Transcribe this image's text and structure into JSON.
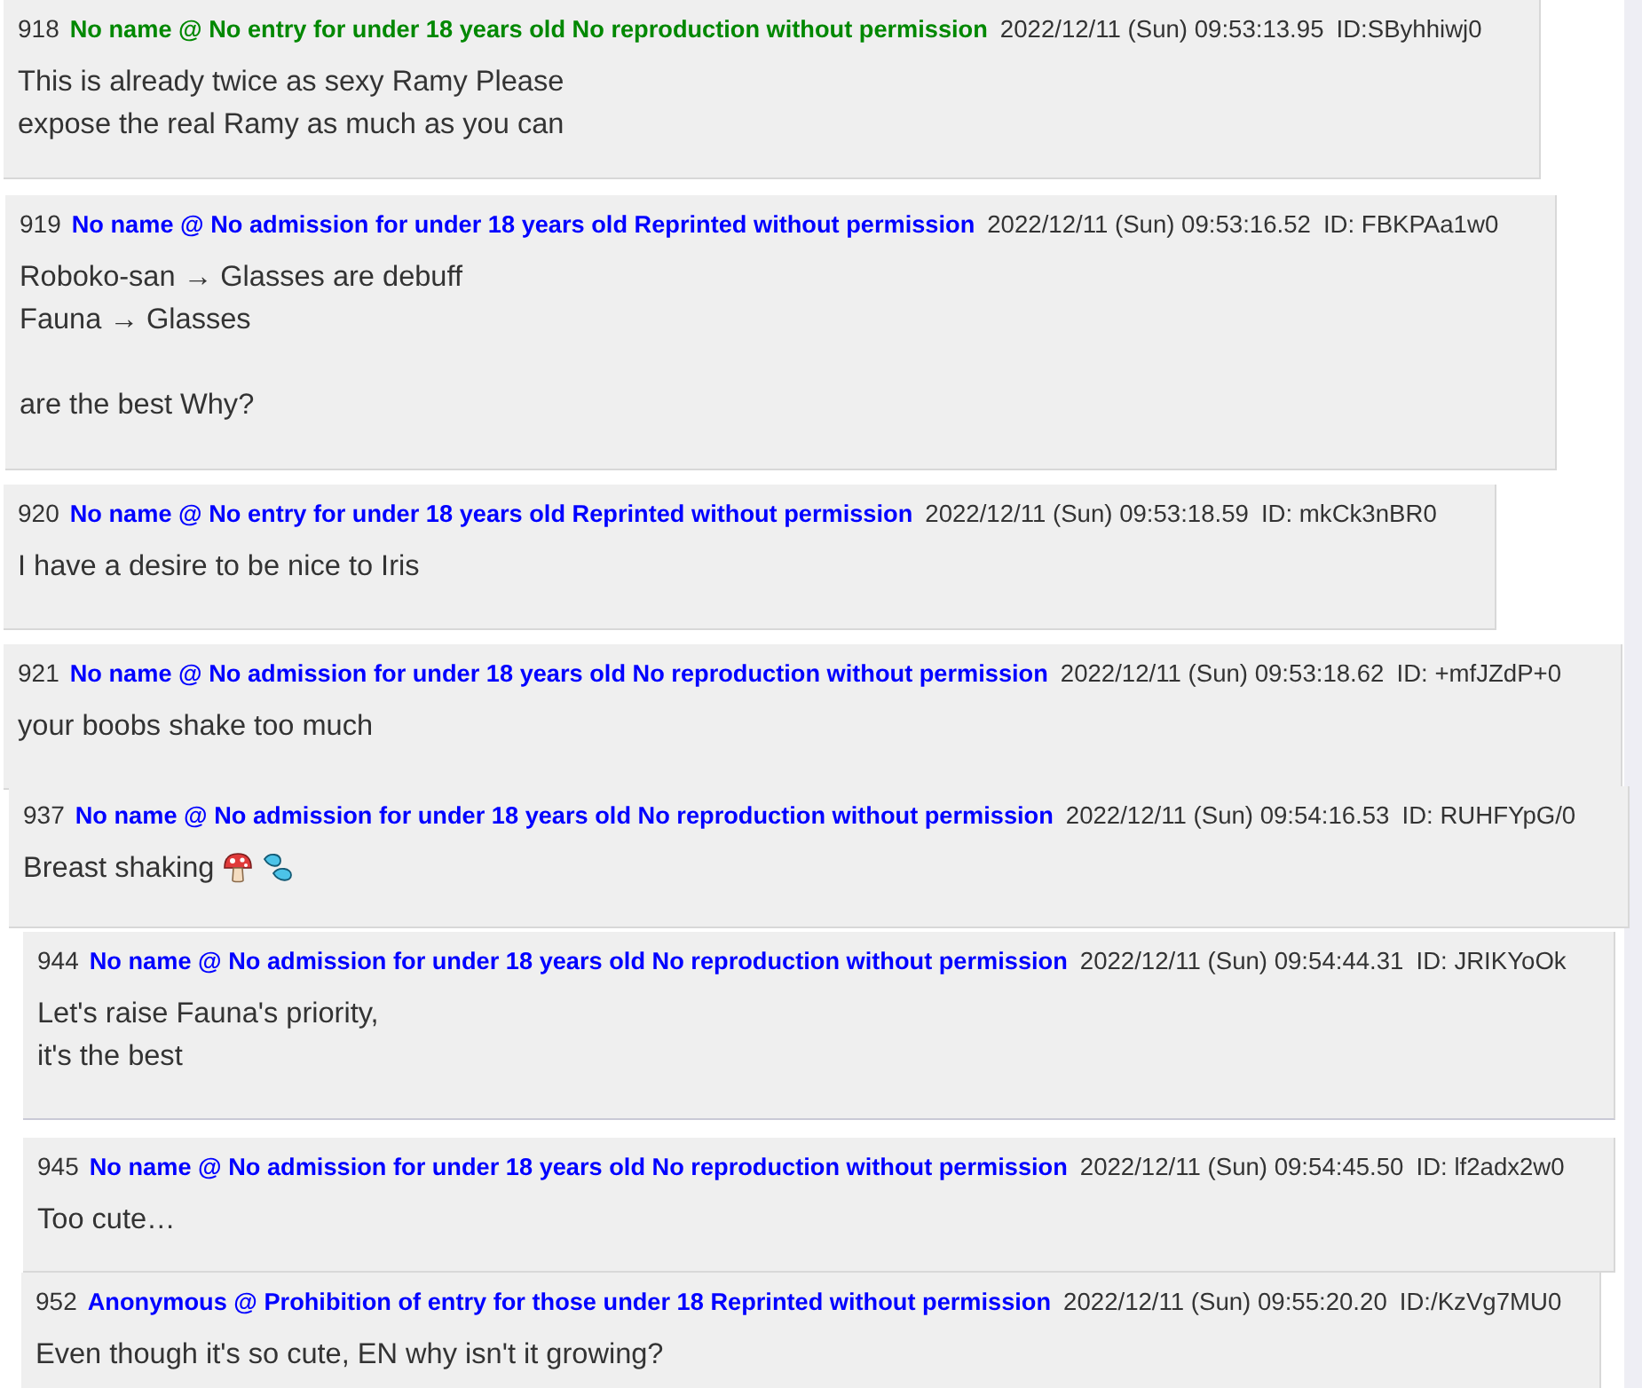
{
  "posts": [
    {
      "number": "918",
      "name": "No name @ No entry for under 18 years old No reproduction without permission",
      "color": "#008800",
      "date": "2022/12/11 (Sun) 09:53:13.95",
      "id": "ID:SByhhiwj0",
      "paragraphs": [
        [
          "This is already twice as sexy Ramy Please",
          "expose the real Ramy as much as you can"
        ]
      ]
    },
    {
      "number": "919",
      "name": "No name @ No admission for under 18 years old Reprinted without permission",
      "color": "#0000ff",
      "date": "2022/12/11 (Sun) 09:53:16.52",
      "id": "ID: FBKPAa1w0",
      "paragraphs": [
        [
          "Roboko-san → Glasses are debuff",
          "Fauna → Glasses"
        ],
        [
          "are the best Why?"
        ]
      ]
    },
    {
      "number": "920",
      "name": "No name @ No entry for under 18 years old Reprinted without permission",
      "color": "#0000ff",
      "date": "2022/12/11 (Sun) 09:53:18.59",
      "id": "ID: mkCk3nBR0",
      "paragraphs": [
        [
          "I have a desire to be nice to Iris"
        ]
      ]
    },
    {
      "number": "921",
      "name": "No name @ No admission for under 18 years old No reproduction without permission",
      "color": "#0000ff",
      "date": "2022/12/11 (Sun) 09:53:18.62",
      "id": "ID: +mfJZdP+0",
      "paragraphs": [
        [
          "your boobs shake too much"
        ]
      ]
    },
    {
      "number": "937",
      "name": "No name @ No admission for under 18 years old No reproduction without permission",
      "color": "#0000ff",
      "date": "2022/12/11 (Sun) 09:54:16.53",
      "id": "ID: RUHFYpG/0",
      "paragraphs": [
        [
          "Breast shaking"
        ]
      ],
      "icons": [
        {
          "kind": "mushroom"
        },
        {
          "kind": "droplets"
        }
      ]
    },
    {
      "number": "944",
      "name": "No name @ No admission for under 18 years old No reproduction without permission",
      "color": "#0000ff",
      "date": "2022/12/11 (Sun) 09:54:44.31",
      "id": "ID: JRIKYoOk",
      "paragraphs": [
        [
          "Let's raise Fauna's priority,",
          "it's the best"
        ]
      ]
    },
    {
      "number": "945",
      "name": "No name @ No admission for under 18 years old No reproduction without permission",
      "color": "#0000ff",
      "date": "2022/12/11 (Sun) 09:54:45.50",
      "id": "ID: lf2adx2w0",
      "paragraphs": [
        [
          "Too cute…"
        ]
      ]
    },
    {
      "number": "952",
      "name": "Anonymous @ Prohibition of entry for those under 18 Reprinted without permission",
      "color": "#0000ff",
      "date": "2022/12/11 (Sun) 09:55:20.20",
      "id": "ID:/KzVg7MU0",
      "paragraphs": [
        [
          "Even though it's so cute, EN why isn't it growing?"
        ]
      ]
    }
  ]
}
